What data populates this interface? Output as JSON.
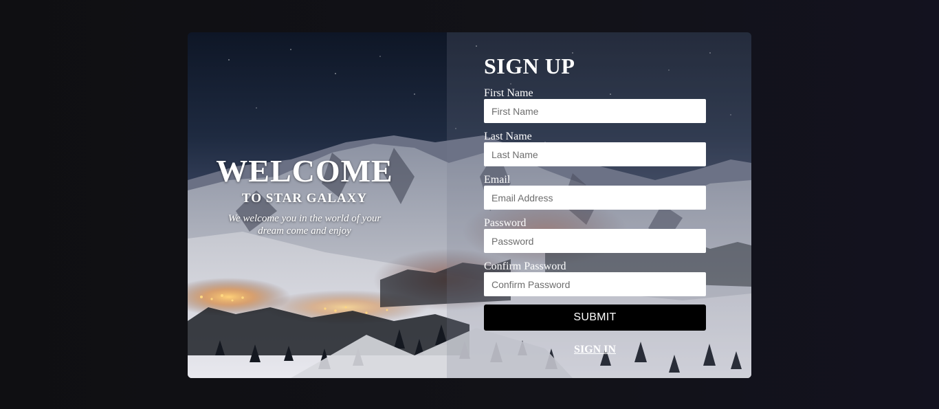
{
  "welcome": {
    "title": "WELCOME",
    "subtitle": "TO STAR GALAXY",
    "tagline": "We welcome you in the world of your dream come and enjoy"
  },
  "signup": {
    "heading": "SIGN UP",
    "fields": [
      {
        "label": "First Name",
        "placeholder": "First Name",
        "value": ""
      },
      {
        "label": "Last Name",
        "placeholder": "Last Name",
        "value": ""
      },
      {
        "label": "Email",
        "placeholder": "Email Address",
        "value": ""
      },
      {
        "label": "Password",
        "placeholder": "Password",
        "value": ""
      },
      {
        "label": "Confirm Password",
        "placeholder": "Confirm Password",
        "value": ""
      }
    ],
    "submit_label": "SUBMIT",
    "signin_label": "SIGN IN"
  },
  "colors": {
    "page_background": "#111116",
    "submit_background": "#000000",
    "text": "#ffffff"
  }
}
